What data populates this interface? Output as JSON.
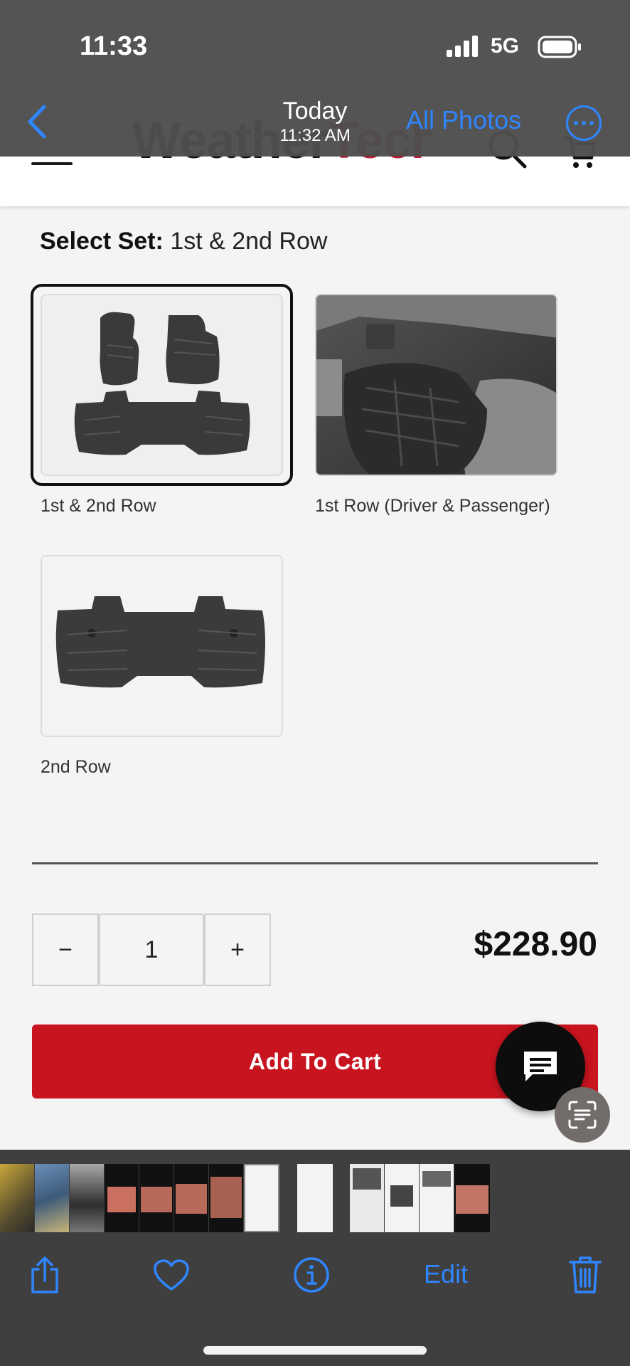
{
  "status_bar": {
    "time": "11:33",
    "network": "5G"
  },
  "photos_nav": {
    "title": "Today",
    "subtitle": "11:32 AM",
    "all_photos_label": "All Photos",
    "accent_color": "#2f86ff"
  },
  "site": {
    "brand_part1": "Weather",
    "brand_part2": "Tech",
    "brand_color": "#c8102e"
  },
  "product": {
    "select_set_label": "Select Set:",
    "select_set_value": "1st & 2nd Row",
    "options": [
      {
        "label": "1st & 2nd Row",
        "selected": true
      },
      {
        "label": "1st Row (Driver & Passenger)",
        "selected": false
      },
      {
        "label": "2nd Row",
        "selected": false
      }
    ],
    "quantity": "1",
    "minus_label": "−",
    "plus_label": "+",
    "price": "$228.90",
    "add_to_cart_label": "Add To Cart",
    "cart_color": "#c8141f"
  },
  "photos_toolbar": {
    "edit_label": "Edit",
    "icons": [
      "share-icon",
      "heart-icon",
      "info-icon",
      "trash-icon"
    ]
  }
}
